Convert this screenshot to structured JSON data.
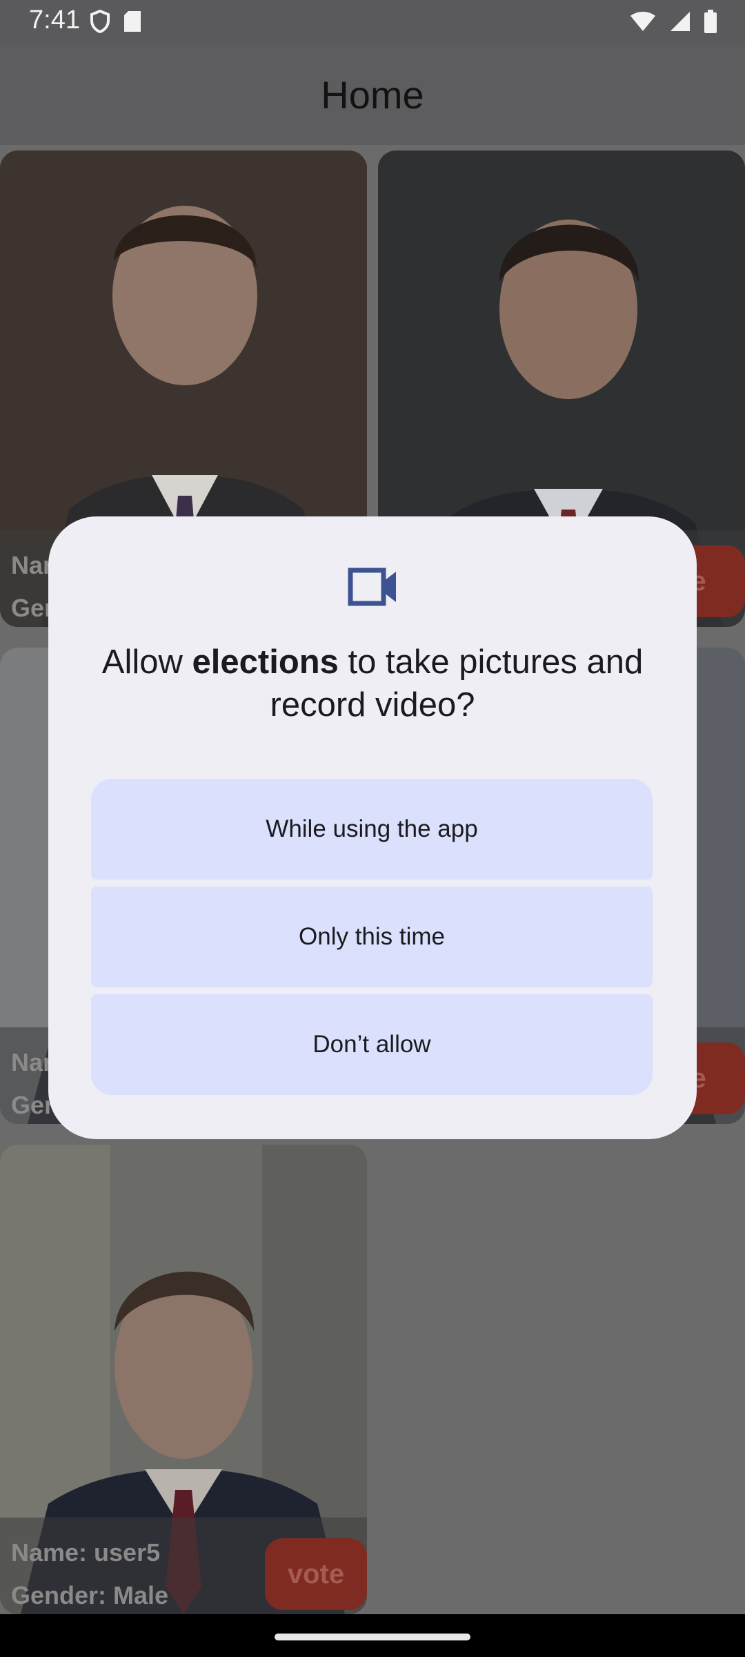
{
  "status_bar": {
    "time": "7:41",
    "left_icons": [
      "shield-icon",
      "sd-card-icon"
    ],
    "right_icons": [
      "wifi-icon",
      "signal-icon",
      "battery-icon"
    ]
  },
  "app_bar": {
    "title": "Home"
  },
  "cards": [
    {
      "name": "Nar",
      "gender": "Ger",
      "vote_label": ""
    },
    {
      "name": "",
      "gender": "",
      "vote_label": "te"
    },
    {
      "name": "Nar",
      "gender": "Ger",
      "vote_label": ""
    },
    {
      "name": "",
      "gender": "",
      "vote_label": "te"
    },
    {
      "name": "Name: user5",
      "gender": "Gender: Male",
      "vote_label": "vote"
    }
  ],
  "dialog": {
    "icon": "video-camera-icon",
    "title_prefix": "Allow ",
    "title_app": "elections",
    "title_suffix": " to take pictures and record video?",
    "buttons": {
      "while_using": "While using the app",
      "only_this_time": "Only this time",
      "dont_allow": "Don’t allow"
    }
  },
  "colors": {
    "dialog_bg": "#efeef4",
    "button_bg": "#dbe1fd",
    "vote_bg": "#7f2b22",
    "icon_accent": "#3d5291"
  }
}
